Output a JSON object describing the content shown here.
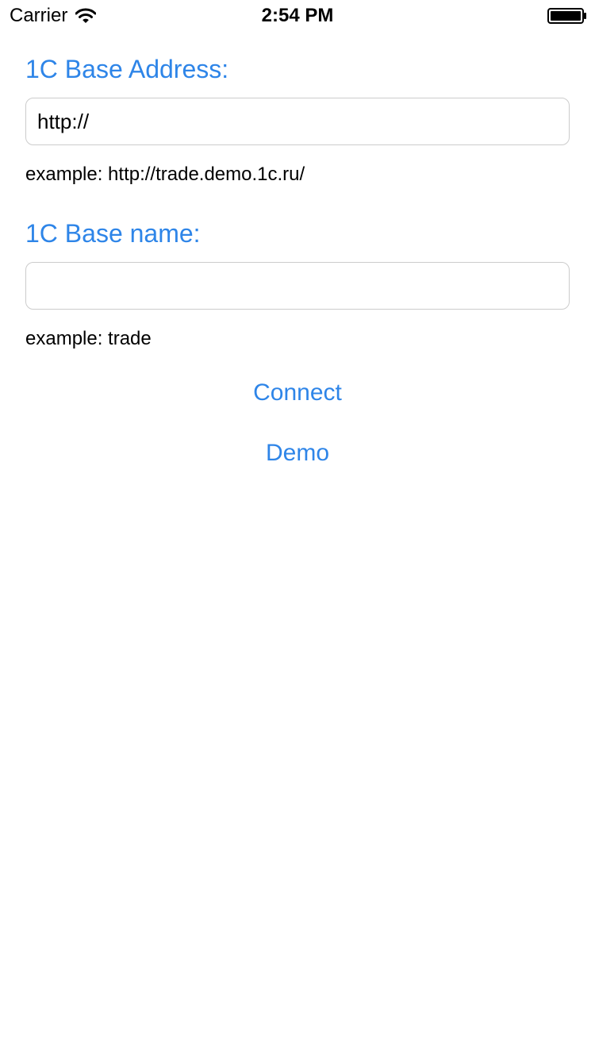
{
  "status_bar": {
    "carrier": "Carrier",
    "time": "2:54 PM",
    "signal_icon": "wifi-icon",
    "battery_icon": "battery-full-icon"
  },
  "form": {
    "address": {
      "label": "1C Base Address:",
      "value": "http://",
      "placeholder": "",
      "hint": "example: http://trade.demo.1c.ru/"
    },
    "name": {
      "label": "1C Base name:",
      "value": "",
      "placeholder": "",
      "hint": "example: trade"
    }
  },
  "actions": {
    "connect_label": "Connect",
    "demo_label": "Demo"
  },
  "colors": {
    "accent": "#2e85e8",
    "field_border": "#cccccc",
    "background": "#ffffff",
    "text": "#000000"
  }
}
